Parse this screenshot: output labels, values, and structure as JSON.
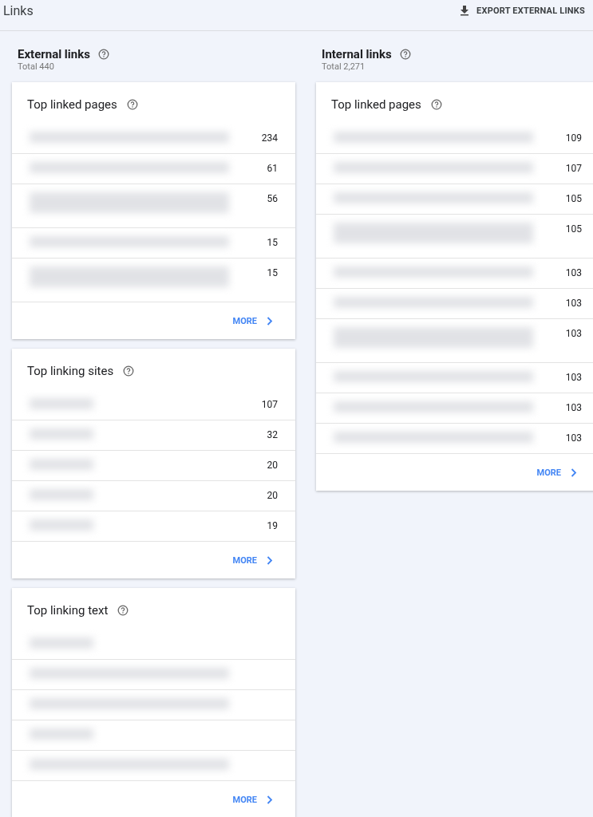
{
  "page": {
    "title": "Links"
  },
  "export_button": {
    "label": "EXPORT EXTERNAL LINKS"
  },
  "columns": [
    {
      "heading": "External links",
      "total": "Total 440",
      "cards": [
        {
          "title": "Top linked pages",
          "more": "MORE",
          "rows": [
            {
              "kind": "single",
              "count": "234"
            },
            {
              "kind": "single",
              "count": "61"
            },
            {
              "kind": "double",
              "count": "56"
            },
            {
              "kind": "single",
              "count": "15"
            },
            {
              "kind": "double",
              "count": "15"
            }
          ]
        },
        {
          "title": "Top linking sites",
          "more": "MORE",
          "rows": [
            {
              "kind": "short",
              "count": "107"
            },
            {
              "kind": "short",
              "count": "32"
            },
            {
              "kind": "short",
              "count": "20"
            },
            {
              "kind": "short",
              "count": "20"
            },
            {
              "kind": "short",
              "count": "19"
            }
          ]
        },
        {
          "title": "Top linking text",
          "more": "MORE",
          "rows": [
            {
              "kind": "short"
            },
            {
              "kind": "single"
            },
            {
              "kind": "single"
            },
            {
              "kind": "short"
            },
            {
              "kind": "single"
            }
          ]
        }
      ]
    },
    {
      "heading": "Internal links",
      "total": "Total 2,271",
      "cards": [
        {
          "title": "Top linked pages",
          "more": "MORE",
          "rows": [
            {
              "kind": "single",
              "count": "109"
            },
            {
              "kind": "single",
              "count": "107"
            },
            {
              "kind": "single",
              "count": "105"
            },
            {
              "kind": "double",
              "count": "105"
            },
            {
              "kind": "single",
              "count": "103"
            },
            {
              "kind": "single",
              "count": "103"
            },
            {
              "kind": "double",
              "count": "103"
            },
            {
              "kind": "single",
              "count": "103"
            },
            {
              "kind": "single",
              "count": "103"
            },
            {
              "kind": "single",
              "count": "103"
            }
          ]
        }
      ]
    }
  ]
}
